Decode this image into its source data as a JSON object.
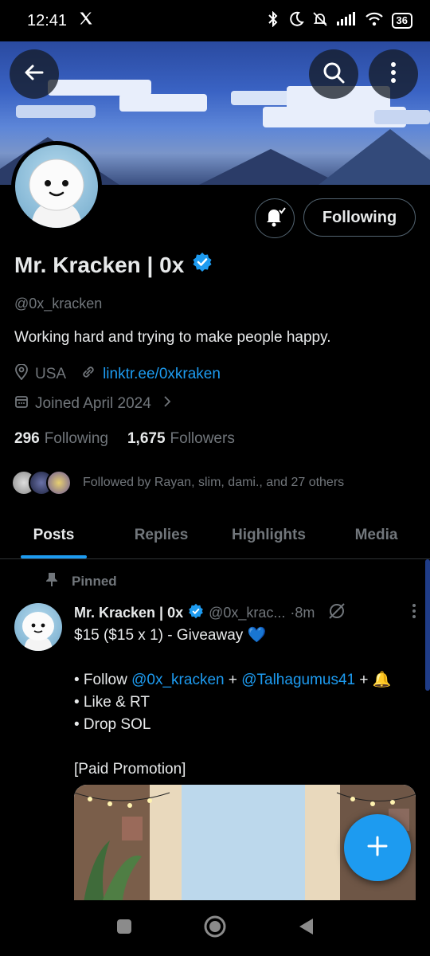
{
  "status_bar": {
    "time": "12:41",
    "app_icon": "x-logo-icon",
    "battery": "36",
    "icons": [
      "bluetooth-icon",
      "moon-icon",
      "bell-muted-icon",
      "signal-icon",
      "wifi-icon"
    ]
  },
  "header": {
    "back_icon": "arrow-left-icon",
    "search_icon": "search-icon",
    "more_icon": "more-vertical-icon"
  },
  "profile": {
    "name": "Mr. Kracken | 0x",
    "verified": true,
    "handle": "@0x_kracken",
    "bio": "Working hard and trying to make people happy.",
    "location": "USA",
    "link": "linktr.ee/0xkraken",
    "joined": "Joined April 2024",
    "following_count": "296",
    "following_label": "Following",
    "followers_count": "1,675",
    "followers_label": "Followers",
    "followed_by": "Followed by Rayan, slim, dami., and 27 others",
    "follow_button": "Following"
  },
  "tabs": [
    {
      "label": "Posts",
      "active": true
    },
    {
      "label": "Replies",
      "active": false
    },
    {
      "label": "Highlights",
      "active": false
    },
    {
      "label": "Media",
      "active": false
    }
  ],
  "post": {
    "pinned_label": "Pinned",
    "author": "Mr. Kracken | 0x",
    "handle": "@0x_krac...",
    "time": "·8m",
    "line1": "$15 ($15 x 1) - Giveaway 💙",
    "follow_prefix": "• Follow ",
    "mention1": "@0x_kracken",
    "plus1": " + ",
    "mention2": "@Talhagumus41",
    "plus2": " + 🔔",
    "line3": "• Like & RT",
    "line4": "• Drop SOL",
    "line5": "[Paid Promotion]"
  },
  "colors": {
    "accent": "#1d9bf0",
    "background": "#000000",
    "muted_text": "#71767b",
    "primary_text": "#e7e9ea"
  }
}
